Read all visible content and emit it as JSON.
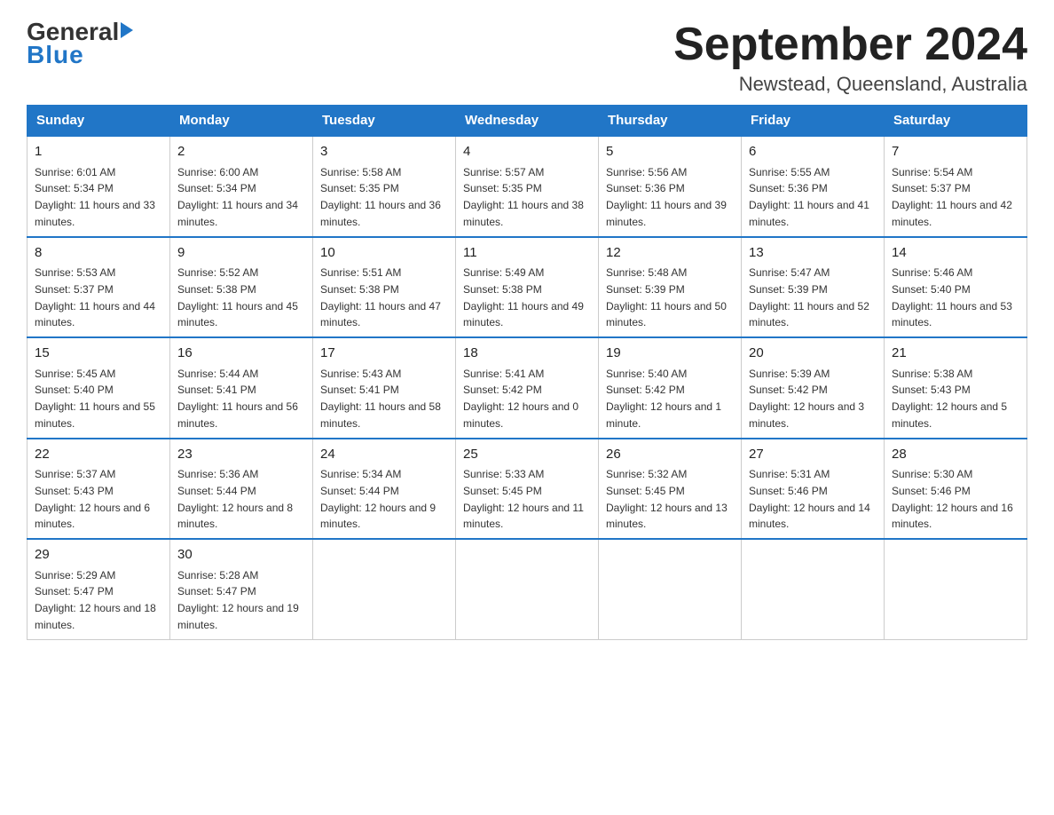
{
  "logo": {
    "general": "General",
    "arrow": "▶",
    "blue": "Blue"
  },
  "header": {
    "title": "September 2024",
    "subtitle": "Newstead, Queensland, Australia"
  },
  "weekdays": [
    "Sunday",
    "Monday",
    "Tuesday",
    "Wednesday",
    "Thursday",
    "Friday",
    "Saturday"
  ],
  "weeks": [
    [
      {
        "day": "1",
        "sunrise": "6:01 AM",
        "sunset": "5:34 PM",
        "daylight": "11 hours and 33 minutes."
      },
      {
        "day": "2",
        "sunrise": "6:00 AM",
        "sunset": "5:34 PM",
        "daylight": "11 hours and 34 minutes."
      },
      {
        "day": "3",
        "sunrise": "5:58 AM",
        "sunset": "5:35 PM",
        "daylight": "11 hours and 36 minutes."
      },
      {
        "day": "4",
        "sunrise": "5:57 AM",
        "sunset": "5:35 PM",
        "daylight": "11 hours and 38 minutes."
      },
      {
        "day": "5",
        "sunrise": "5:56 AM",
        "sunset": "5:36 PM",
        "daylight": "11 hours and 39 minutes."
      },
      {
        "day": "6",
        "sunrise": "5:55 AM",
        "sunset": "5:36 PM",
        "daylight": "11 hours and 41 minutes."
      },
      {
        "day": "7",
        "sunrise": "5:54 AM",
        "sunset": "5:37 PM",
        "daylight": "11 hours and 42 minutes."
      }
    ],
    [
      {
        "day": "8",
        "sunrise": "5:53 AM",
        "sunset": "5:37 PM",
        "daylight": "11 hours and 44 minutes."
      },
      {
        "day": "9",
        "sunrise": "5:52 AM",
        "sunset": "5:38 PM",
        "daylight": "11 hours and 45 minutes."
      },
      {
        "day": "10",
        "sunrise": "5:51 AM",
        "sunset": "5:38 PM",
        "daylight": "11 hours and 47 minutes."
      },
      {
        "day": "11",
        "sunrise": "5:49 AM",
        "sunset": "5:38 PM",
        "daylight": "11 hours and 49 minutes."
      },
      {
        "day": "12",
        "sunrise": "5:48 AM",
        "sunset": "5:39 PM",
        "daylight": "11 hours and 50 minutes."
      },
      {
        "day": "13",
        "sunrise": "5:47 AM",
        "sunset": "5:39 PM",
        "daylight": "11 hours and 52 minutes."
      },
      {
        "day": "14",
        "sunrise": "5:46 AM",
        "sunset": "5:40 PM",
        "daylight": "11 hours and 53 minutes."
      }
    ],
    [
      {
        "day": "15",
        "sunrise": "5:45 AM",
        "sunset": "5:40 PM",
        "daylight": "11 hours and 55 minutes."
      },
      {
        "day": "16",
        "sunrise": "5:44 AM",
        "sunset": "5:41 PM",
        "daylight": "11 hours and 56 minutes."
      },
      {
        "day": "17",
        "sunrise": "5:43 AM",
        "sunset": "5:41 PM",
        "daylight": "11 hours and 58 minutes."
      },
      {
        "day": "18",
        "sunrise": "5:41 AM",
        "sunset": "5:42 PM",
        "daylight": "12 hours and 0 minutes."
      },
      {
        "day": "19",
        "sunrise": "5:40 AM",
        "sunset": "5:42 PM",
        "daylight": "12 hours and 1 minute."
      },
      {
        "day": "20",
        "sunrise": "5:39 AM",
        "sunset": "5:42 PM",
        "daylight": "12 hours and 3 minutes."
      },
      {
        "day": "21",
        "sunrise": "5:38 AM",
        "sunset": "5:43 PM",
        "daylight": "12 hours and 5 minutes."
      }
    ],
    [
      {
        "day": "22",
        "sunrise": "5:37 AM",
        "sunset": "5:43 PM",
        "daylight": "12 hours and 6 minutes."
      },
      {
        "day": "23",
        "sunrise": "5:36 AM",
        "sunset": "5:44 PM",
        "daylight": "12 hours and 8 minutes."
      },
      {
        "day": "24",
        "sunrise": "5:34 AM",
        "sunset": "5:44 PM",
        "daylight": "12 hours and 9 minutes."
      },
      {
        "day": "25",
        "sunrise": "5:33 AM",
        "sunset": "5:45 PM",
        "daylight": "12 hours and 11 minutes."
      },
      {
        "day": "26",
        "sunrise": "5:32 AM",
        "sunset": "5:45 PM",
        "daylight": "12 hours and 13 minutes."
      },
      {
        "day": "27",
        "sunrise": "5:31 AM",
        "sunset": "5:46 PM",
        "daylight": "12 hours and 14 minutes."
      },
      {
        "day": "28",
        "sunrise": "5:30 AM",
        "sunset": "5:46 PM",
        "daylight": "12 hours and 16 minutes."
      }
    ],
    [
      {
        "day": "29",
        "sunrise": "5:29 AM",
        "sunset": "5:47 PM",
        "daylight": "12 hours and 18 minutes."
      },
      {
        "day": "30",
        "sunrise": "5:28 AM",
        "sunset": "5:47 PM",
        "daylight": "12 hours and 19 minutes."
      },
      null,
      null,
      null,
      null,
      null
    ]
  ]
}
